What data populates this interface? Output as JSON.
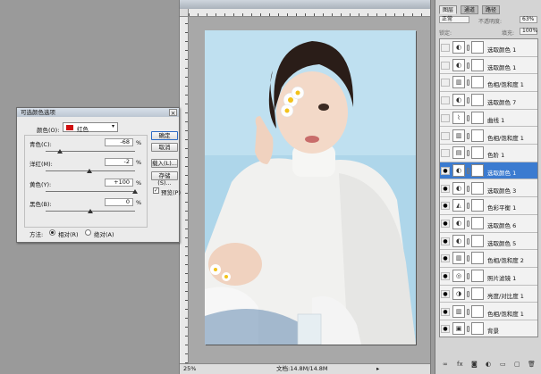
{
  "document": {
    "title": "",
    "zoom": "25%",
    "doc_info": "文档:14.8M/14.8M",
    "status_arrow": "▸"
  },
  "dialog": {
    "title": "可选颜色选项",
    "close": "×",
    "colors_label": "颜色(O):",
    "colors_value": "红色",
    "dropdown_arrow": "▾",
    "sliders": [
      {
        "label": "青色(C):",
        "value": "-68",
        "level": -68
      },
      {
        "label": "洋红(M):",
        "value": "-2",
        "level": -2
      },
      {
        "label": "黄色(Y):",
        "value": "+100",
        "level": 100
      },
      {
        "label": "黑色(B):",
        "value": "0",
        "level": 0
      }
    ],
    "percent": "%",
    "buttons": {
      "ok": "确定",
      "cancel": "取消",
      "load": "载入(L)...",
      "save": "存储(S)..."
    },
    "preview_label": "预览(P)",
    "preview_checked": "✓",
    "method_label": "方法:",
    "method_relative": "相对(R)",
    "method_absolute": "绝对(A)"
  },
  "panel": {
    "tabs": [
      "图层",
      "通道",
      "路径"
    ],
    "blend_mode": "正常",
    "opacity_label": "不透明度:",
    "opacity_value": "63%",
    "lock_label": "锁定:",
    "fill_label": "填充:",
    "fill_value": "100%",
    "layers": [
      {
        "name": "选取颜色 1",
        "icon": "◐",
        "visible": "",
        "selected": false
      },
      {
        "name": "选取颜色 1",
        "icon": "◐",
        "visible": "",
        "selected": false
      },
      {
        "name": "色相/饱和度 1",
        "icon": "▥",
        "visible": "",
        "selected": false
      },
      {
        "name": "选取颜色 7",
        "icon": "◐",
        "visible": "",
        "selected": false
      },
      {
        "name": "曲线 1",
        "icon": "⌇",
        "visible": "",
        "selected": false
      },
      {
        "name": "色相/饱和度 1",
        "icon": "▥",
        "visible": "",
        "selected": false
      },
      {
        "name": "色阶 1",
        "icon": "▤",
        "visible": "",
        "selected": false
      },
      {
        "name": "选取颜色 1",
        "icon": "◐",
        "visible": "●",
        "selected": true
      },
      {
        "name": "选取颜色 3",
        "icon": "◐",
        "visible": "●",
        "selected": false
      },
      {
        "name": "色彩平衡 1",
        "icon": "◭",
        "visible": "●",
        "selected": false
      },
      {
        "name": "选取颜色 6",
        "icon": "◐",
        "visible": "●",
        "selected": false
      },
      {
        "name": "选取颜色 5",
        "icon": "◐",
        "visible": "●",
        "selected": false
      },
      {
        "name": "色相/饱和度 2",
        "icon": "▥",
        "visible": "●",
        "selected": false
      },
      {
        "name": "照片滤镜 1",
        "icon": "◎",
        "visible": "●",
        "selected": false
      },
      {
        "name": "亮度/对比度 1",
        "icon": "◑",
        "visible": "●",
        "selected": false
      },
      {
        "name": "色相/饱和度 1",
        "icon": "▥",
        "visible": "●",
        "selected": false
      },
      {
        "name": "背景",
        "icon": "▣",
        "visible": "●",
        "selected": false
      }
    ],
    "footer_icons": [
      "∞",
      "fx",
      "◙",
      "◐",
      "▭",
      "▢",
      "🗑"
    ]
  }
}
